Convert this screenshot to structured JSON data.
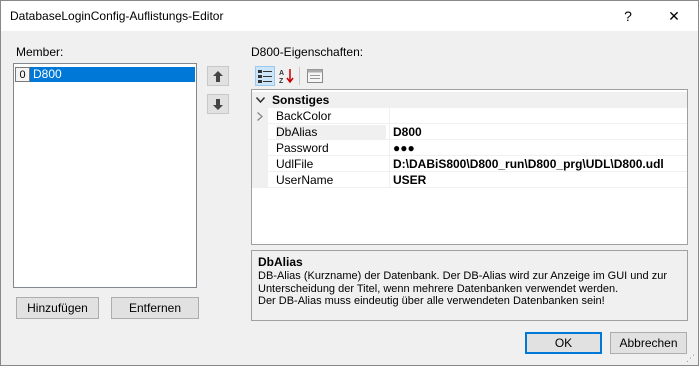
{
  "window": {
    "title": "DatabaseLoginConfig-Auflistungs-Editor",
    "help_glyph": "?",
    "close_glyph": "✕"
  },
  "members": {
    "label": "Member:",
    "items": [
      {
        "index": "0",
        "name": "D800"
      }
    ]
  },
  "properties": {
    "label": "D800-Eigenschaften:",
    "category": "Sonstiges",
    "rows": [
      {
        "name": "BackColor",
        "value": "",
        "expandable": true
      },
      {
        "name": "DbAlias",
        "value": "D800",
        "selected": true
      },
      {
        "name": "Password",
        "value": "●●●"
      },
      {
        "name": "UdlFile",
        "value": "D:\\DABiS800\\D800_run\\D800_prg\\UDL\\D800.udl"
      },
      {
        "name": "UserName",
        "value": "USER"
      }
    ]
  },
  "description": {
    "title": "DbAlias",
    "line1": "DB-Alias (Kurzname) der Datenbank. Der DB-Alias wird zur Anzeige im GUI und zur",
    "line2": "Unterscheidung der Titel, wenn mehrere Datenbanken verwendet werden.",
    "line3": "Der DB-Alias muss eindeutig über alle verwendeten Datenbanken sein!"
  },
  "buttons": {
    "add": "Hinzufügen",
    "remove": "Entfernen",
    "ok": "OK",
    "cancel": "Abbrechen"
  }
}
